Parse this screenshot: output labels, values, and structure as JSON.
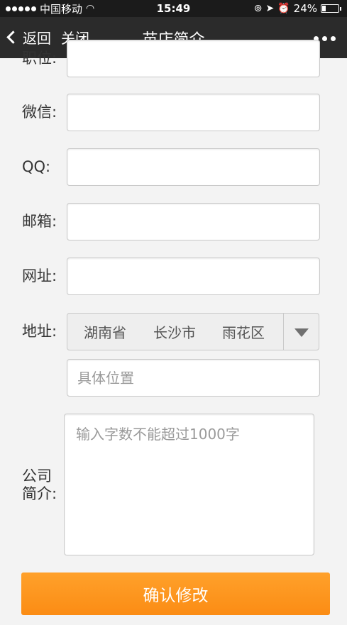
{
  "status_bar": {
    "carrier": "中国移动",
    "time": "15:49",
    "battery": "24%",
    "battery_level": 0.24
  },
  "nav": {
    "back_label": "返回",
    "close_label": "关闭",
    "title": "苗店简介"
  },
  "form": {
    "position_label": "职位:",
    "wechat_label": "微信:",
    "qq_label": "QQ:",
    "email_label": "邮箱:",
    "website_label": "网址:",
    "address_label": "地址:",
    "intro_label_1": "公司",
    "intro_label_2": "简介:",
    "position_value": "",
    "wechat_value": "",
    "qq_value": "",
    "email_value": "",
    "website_value": "",
    "region": {
      "province": "湖南省",
      "city": "长沙市",
      "district": "雨花区"
    },
    "detail_placeholder": "具体位置",
    "intro_placeholder": "输入字数不能超过1000字"
  },
  "submit_label": "确认修改"
}
